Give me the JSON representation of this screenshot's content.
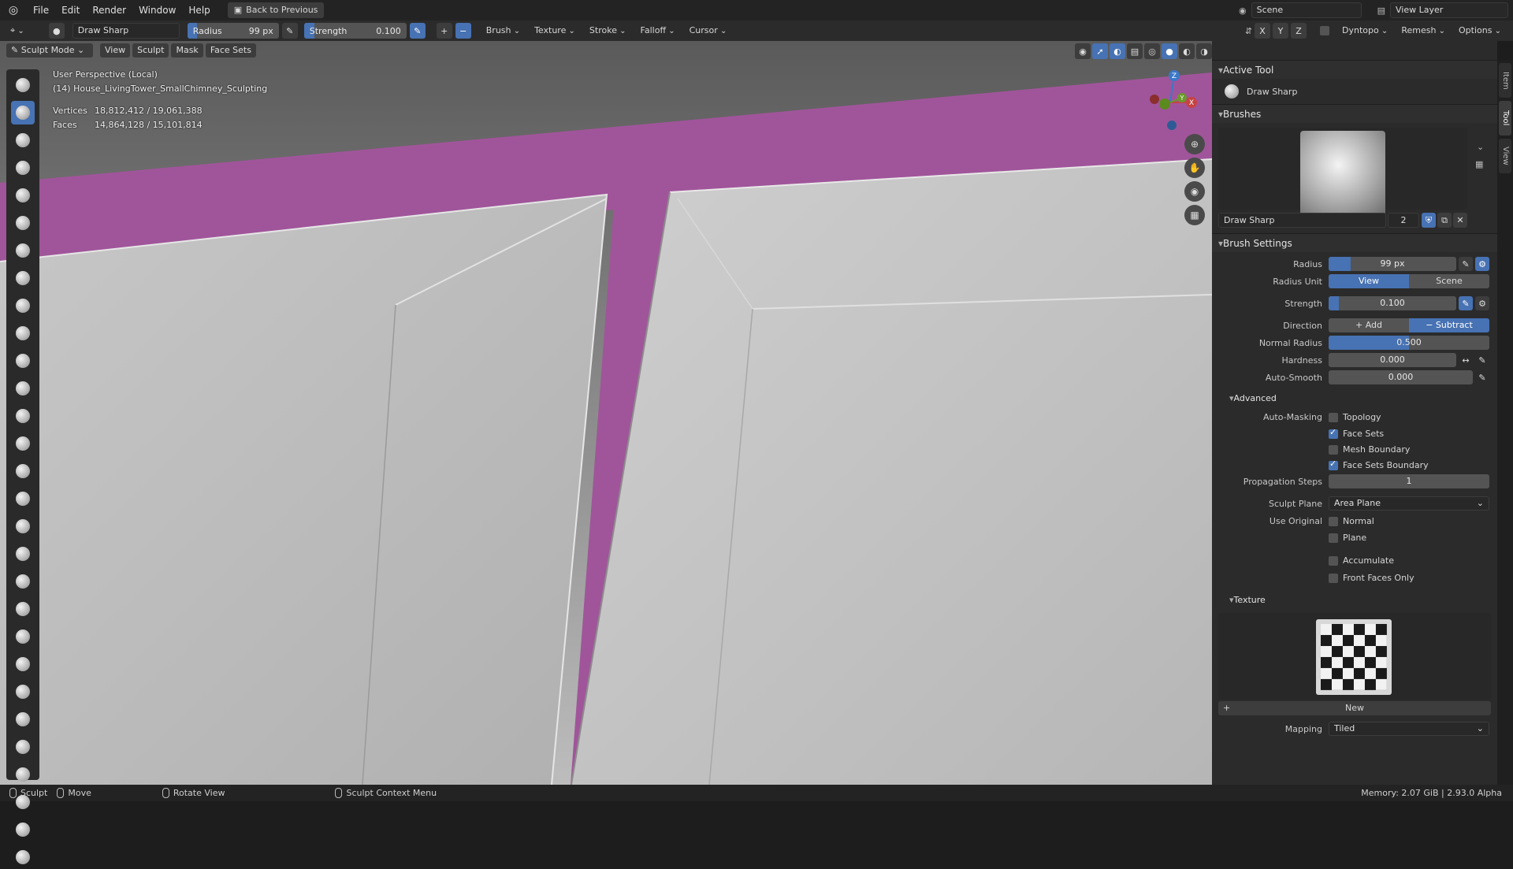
{
  "topbar": {
    "menu": [
      "File",
      "Edit",
      "Render",
      "Window",
      "Help"
    ],
    "back_button": "Back to Previous",
    "scene": "Scene",
    "view_layer": "View Layer"
  },
  "header": {
    "brush_name": "Draw Sharp",
    "radius_label": "Radius",
    "radius_value": "99 px",
    "radius_fraction": 0.1,
    "strength_label": "Strength",
    "strength_value": "0.100",
    "strength_fraction": 0.1,
    "menus": [
      "Brush",
      "Texture",
      "Stroke",
      "Falloff",
      "Cursor"
    ],
    "symmetry_axes": [
      "X",
      "Y",
      "Z"
    ],
    "dyntopo": "Dyntopo",
    "remesh": "Remesh",
    "options": "Options"
  },
  "tool_header": {
    "mode": "Sculpt Mode",
    "menus": [
      "View",
      "Sculpt",
      "Mask",
      "Face Sets"
    ]
  },
  "viewport": {
    "perspective": "User Perspective (Local)",
    "object": "(14) House_LivingTower_SmallChimney_Sculpting",
    "vertices_label": "Vertices",
    "vertices_value": "18,812,412 / 19,061,388",
    "faces_label": "Faces",
    "faces_value": "14,864,128 / 15,101,814",
    "gizmo": {
      "x": "X",
      "y": "Y",
      "z": "Z"
    },
    "colors": {
      "mesh": "#b4b4b4",
      "face_set": "#a0559a"
    }
  },
  "sidebar": {
    "tabs": [
      "Item",
      "Tool",
      "View"
    ],
    "active_tool_title": "Active Tool",
    "active_tool_name": "Draw Sharp",
    "brushes_title": "Brushes",
    "brush_name": "Draw Sharp",
    "brush_users": "2",
    "brush_settings_title": "Brush Settings",
    "radius_label": "Radius",
    "radius_value": "99 px",
    "radius_unit_label": "Radius Unit",
    "radius_unit_options": [
      "View",
      "Scene"
    ],
    "strength_label": "Strength",
    "strength_value": "0.100",
    "direction_label": "Direction",
    "direction_options": [
      "Add",
      "Subtract"
    ],
    "normal_radius_label": "Normal Radius",
    "normal_radius_value": "0.500",
    "normal_radius_fraction": 0.5,
    "hardness_label": "Hardness",
    "hardness_value": "0.000",
    "auto_smooth_label": "Auto-Smooth",
    "auto_smooth_value": "0.000",
    "advanced_title": "Advanced",
    "auto_masking_label": "Auto-Masking",
    "topology": "Topology",
    "face_sets": "Face Sets",
    "mesh_boundary": "Mesh Boundary",
    "face_sets_boundary": "Face Sets Boundary",
    "propagation_label": "Propagation Steps",
    "propagation_value": "1",
    "sculpt_plane_label": "Sculpt Plane",
    "sculpt_plane_value": "Area Plane",
    "use_original_label": "Use Original",
    "normal": "Normal",
    "plane": "Plane",
    "accumulate": "Accumulate",
    "front_faces_only": "Front Faces Only",
    "texture_title": "Texture",
    "new_button": "New",
    "mapping_label": "Mapping",
    "mapping_value": "Tiled"
  },
  "statusbar": {
    "sculpt": "Sculpt",
    "move": "Move",
    "rotate": "Rotate View",
    "context": "Sculpt Context Menu",
    "memory": "Memory: 2.07 GiB | 2.93.0 Alpha"
  },
  "colors": {
    "accent": "#4772b3"
  }
}
